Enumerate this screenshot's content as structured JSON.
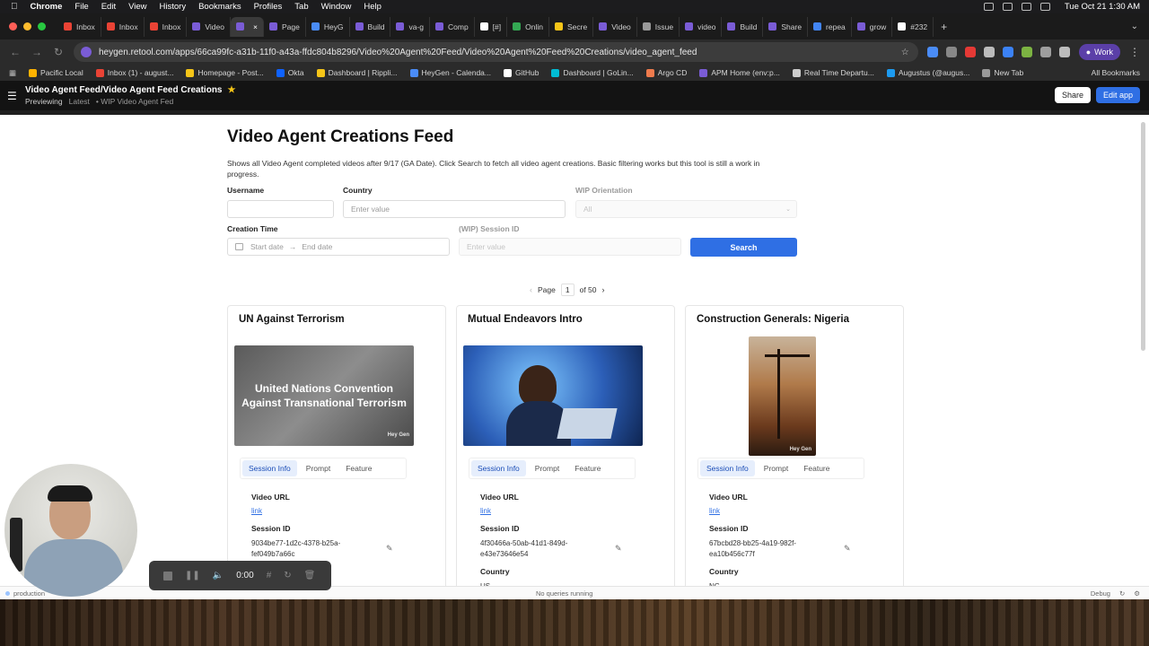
{
  "menubar": {
    "app": "Chrome",
    "items": [
      "File",
      "Edit",
      "View",
      "History",
      "Bookmarks",
      "Profiles",
      "Tab",
      "Window",
      "Help"
    ],
    "clock": "Tue Oct 21  1:30 AM"
  },
  "tabs": [
    {
      "label": "Inbox",
      "color": "#ea4335"
    },
    {
      "label": "Inbox",
      "color": "#ea4335"
    },
    {
      "label": "Inbox",
      "color": "#ea4335"
    },
    {
      "label": "Video",
      "color": "#7a5cd6"
    },
    {
      "label": "",
      "color": "#7a5cd6"
    },
    {
      "label": "Page",
      "color": "#7a5cd6"
    },
    {
      "label": "HeyG",
      "color": "#4a8cf7"
    },
    {
      "label": "Build",
      "color": "#7a5cd6"
    },
    {
      "label": "va-g",
      "color": "#7a5cd6"
    },
    {
      "label": "Comp",
      "color": "#7a5cd6"
    },
    {
      "label": "[#]",
      "color": "#ffffff"
    },
    {
      "label": "Onlin",
      "color": "#34a853"
    },
    {
      "label": "Secre",
      "color": "#f5c518"
    },
    {
      "label": "Video",
      "color": "#7a5cd6"
    },
    {
      "label": "Issue",
      "color": "#999999"
    },
    {
      "label": "video",
      "color": "#7a5cd6"
    },
    {
      "label": "Build",
      "color": "#7a5cd6"
    },
    {
      "label": "Share",
      "color": "#7a5cd6"
    },
    {
      "label": "repea",
      "color": "#4285f4"
    },
    {
      "label": "grow",
      "color": "#7a5cd6"
    },
    {
      "label": "#232",
      "color": "#ffffff"
    }
  ],
  "address": {
    "url": "heygen.retool.com/apps/66ca99fc-a31b-11f0-a43a-ffdc804b8296/Video%20Agent%20Feed/Video%20Agent%20Feed%20Creations/video_agent_feed",
    "profile_label": "Work"
  },
  "bookmarks": [
    {
      "label": "Pacific Local",
      "color": "#ffb300"
    },
    {
      "label": "Inbox (1) - august...",
      "color": "#ea4335"
    },
    {
      "label": "Homepage - Post...",
      "color": "#f5c518"
    },
    {
      "label": "Okta",
      "color": "#0f62fe"
    },
    {
      "label": "Dashboard | Rippli...",
      "color": "#f5c518"
    },
    {
      "label": "HeyGen - Calenda...",
      "color": "#4a8cf7"
    },
    {
      "label": "GitHub",
      "color": "#ffffff"
    },
    {
      "label": "Dashboard | GoLin...",
      "color": "#00bcd4"
    },
    {
      "label": "Argo CD",
      "color": "#ef7b4d"
    },
    {
      "label": "APM Home (env:p...",
      "color": "#7a5cd6"
    },
    {
      "label": "Real Time Departu...",
      "color": "#cccccc"
    },
    {
      "label": "Augustus (@augus...",
      "color": "#1d9bf0"
    },
    {
      "label": "New Tab",
      "color": "#999999"
    }
  ],
  "all_bookmarks": "All Bookmarks",
  "app_header": {
    "title": "Video Agent Feed/Video Agent Feed Creations",
    "mode": "Previewing",
    "version": "Latest",
    "branch": "• WIP Video Agent Fed",
    "share_label": "Share",
    "edit_label": "Edit app"
  },
  "page": {
    "title": "Video Agent Creations Feed",
    "description": "Shows all Video Agent completed videos after 9/17 (GA Date). Click Search to fetch all video agent creations. Basic filtering works but this tool is still a work in progress."
  },
  "filters": {
    "username": {
      "label": "Username",
      "value": ""
    },
    "country": {
      "label": "Country",
      "placeholder": "Enter value"
    },
    "orientation": {
      "label": "WIP Orientation",
      "value": "All"
    },
    "creation_time": {
      "label": "Creation Time",
      "start": "Start date",
      "sep": "→",
      "end": "End date"
    },
    "session_id": {
      "label": "(WIP) Session ID",
      "placeholder": "Enter value"
    },
    "search_label": "Search"
  },
  "pagination": {
    "prefix": "Page",
    "page": "1",
    "suffix": "of 50"
  },
  "cards": [
    {
      "title": "UN Against Terrorism",
      "thumb_text": "United Nations Convention Against Transnational Terrorism",
      "watermark": "Hey Gen",
      "tabs": [
        "Session Info",
        "Prompt",
        "Feature"
      ],
      "video_url_label": "Video URL",
      "video_url": "link",
      "session_label": "Session ID",
      "session_id": "9034be77-1d2c-4378-b25a-fef049b7a66c",
      "country_label": ""
    },
    {
      "title": "Mutual Endeavors Intro",
      "thumb_text": "",
      "watermark": "",
      "tabs": [
        "Session Info",
        "Prompt",
        "Feature"
      ],
      "video_url_label": "Video URL",
      "video_url": "link",
      "session_label": "Session ID",
      "session_id": "4f30466a-50ab-41d1-849d-e43e73646e54",
      "country_label": "Country",
      "country": "US"
    },
    {
      "title": "Construction Generals: Nigeria",
      "thumb_text": "",
      "watermark": "Hey Gen",
      "tabs": [
        "Session Info",
        "Prompt",
        "Feature"
      ],
      "video_url_label": "Video URL",
      "video_url": "link",
      "session_label": "Session ID",
      "session_id": "67bcbd28-bb25-4a19-982f-ea10b456c77f",
      "country_label": "Country",
      "country": "NG"
    }
  ],
  "statusbar": {
    "env": "production",
    "queries": "No queries running",
    "debug": "Debug"
  },
  "recorder": {
    "time": "0:00"
  }
}
